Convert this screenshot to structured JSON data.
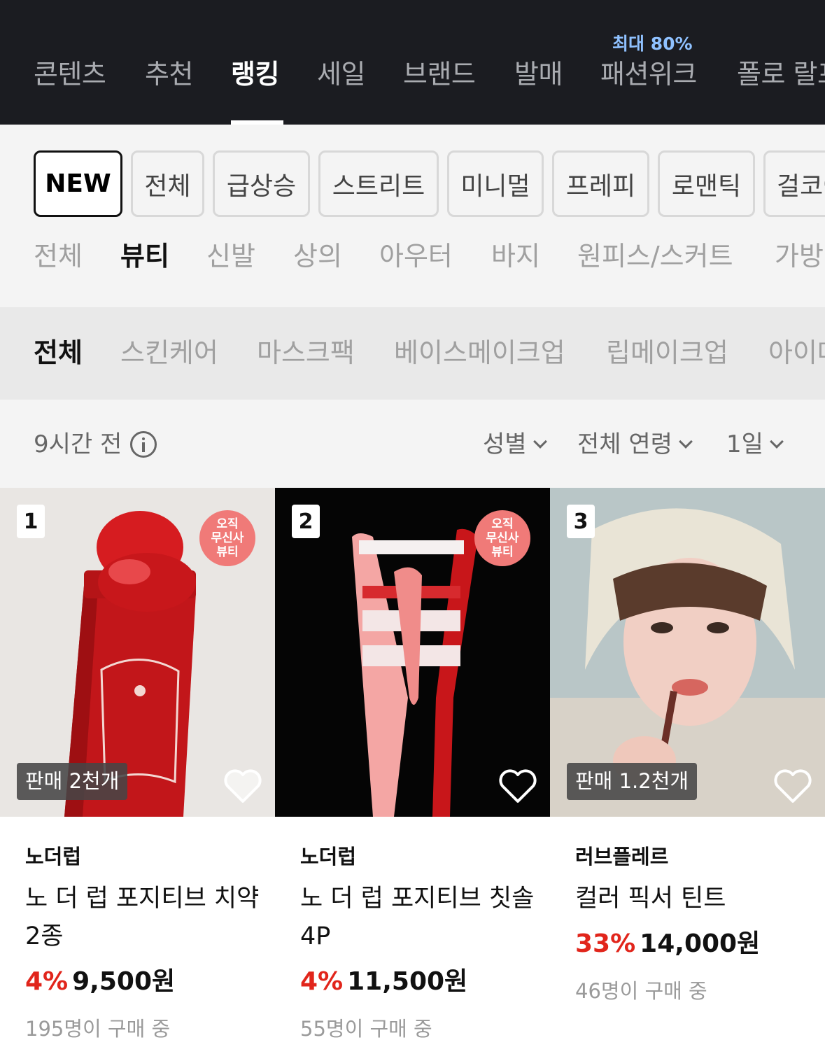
{
  "top_nav": {
    "tabs": [
      "콘텐츠",
      "추천",
      "랭킹",
      "세일",
      "브랜드",
      "발매",
      "패션위크",
      "폴로 랄프"
    ],
    "active_tab": "랭킹",
    "promo_label": "최대 80%"
  },
  "style_chips": [
    "NEW",
    "전체",
    "급상승",
    "스트리트",
    "미니멀",
    "프레피",
    "로맨틱",
    "걸코어"
  ],
  "categories": [
    "전체",
    "뷰티",
    "신발",
    "상의",
    "아우터",
    "바지",
    "원피스/스커트",
    "가방"
  ],
  "subcategories": [
    "전체",
    "스킨케어",
    "마스크팩",
    "베이스메이크업",
    "립메이크업",
    "아이메이크업"
  ],
  "info": {
    "updated": "9시간 전",
    "filters": [
      "성별",
      "전체 연령",
      "1일"
    ]
  },
  "products": [
    {
      "rank": "1",
      "badge": "오직\n무신사\n뷰티",
      "sold": "판매 2천개",
      "brand": "노더럽",
      "name": "노 더 럽 포지티브 치약 2종",
      "discount": "4%",
      "price": "9,500원",
      "buyers": "195명이 구매 중"
    },
    {
      "rank": "2",
      "badge": "오직\n무신사\n뷰티",
      "sold": "",
      "brand": "노더럽",
      "name": "노 더 럽 포지티브 칫솔 4P",
      "discount": "4%",
      "price": "11,500원",
      "buyers": "55명이 구매 중"
    },
    {
      "rank": "3",
      "badge": "",
      "sold": "판매 1.2천개",
      "brand": "러브플레르",
      "name": "컬러 픽서 틴트",
      "discount": "33%",
      "price": "14,000원",
      "buyers": "46명이 구매 중"
    }
  ],
  "colors": {
    "nav_bg": "#1b1c21",
    "promo": "#8fc1ff",
    "discount": "#e1251b",
    "badge": "#f07a78"
  }
}
